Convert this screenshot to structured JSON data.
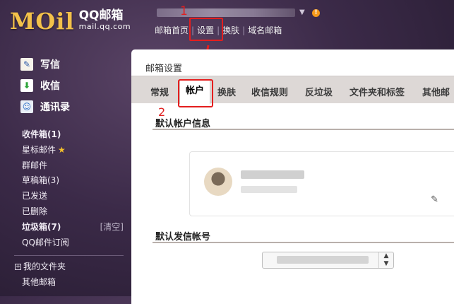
{
  "header": {
    "logo_mark_left": "M",
    "logo_mark_o": "O",
    "logo_mark_right": "il",
    "logo_title": "QQ邮箱",
    "logo_url": "mail.qq.com",
    "account_arrow": "▼",
    "warning_glyph": "!",
    "annotation_1": "1",
    "nav": [
      "邮箱首页",
      "设置",
      "换肤",
      "域名邮箱"
    ],
    "nav_separator": "|"
  },
  "sidebar": {
    "primary": [
      {
        "label": "写信",
        "icon": "write-icon"
      },
      {
        "label": "收信",
        "icon": "inbox-download-icon"
      },
      {
        "label": "通讯录",
        "icon": "contacts-icon"
      }
    ],
    "folders": [
      {
        "label": "收件箱(1)",
        "bold": true
      },
      {
        "label": "星标邮件",
        "star": "★"
      },
      {
        "label": "群邮件"
      },
      {
        "label": "草稿箱(3)"
      },
      {
        "label": "已发送"
      },
      {
        "label": "已删除"
      },
      {
        "label": "垃圾箱(7)",
        "bold": true,
        "action": "[清空]"
      },
      {
        "label": "QQ邮件订阅"
      }
    ],
    "tree": [
      {
        "label": "我的文件夹",
        "expander": "+"
      },
      {
        "label": "其他邮箱"
      }
    ]
  },
  "main": {
    "title": "邮箱设置",
    "tabs": [
      "常规",
      "帐户",
      "换肤",
      "收信规则",
      "反垃圾",
      "文件夹和标签",
      "其他邮"
    ],
    "active_tab": "帐户",
    "annotation_2": "2",
    "section_default_account": "默认帐户信息",
    "section_default_sender": "默认发信帐号",
    "edit_glyph": "✎",
    "select_caret_up": "▲",
    "select_caret_down": "▼"
  },
  "colors": {
    "annotation_red": "#e41e1e",
    "warning_orange": "#f59a1b",
    "star_yellow": "#f5c12a"
  }
}
